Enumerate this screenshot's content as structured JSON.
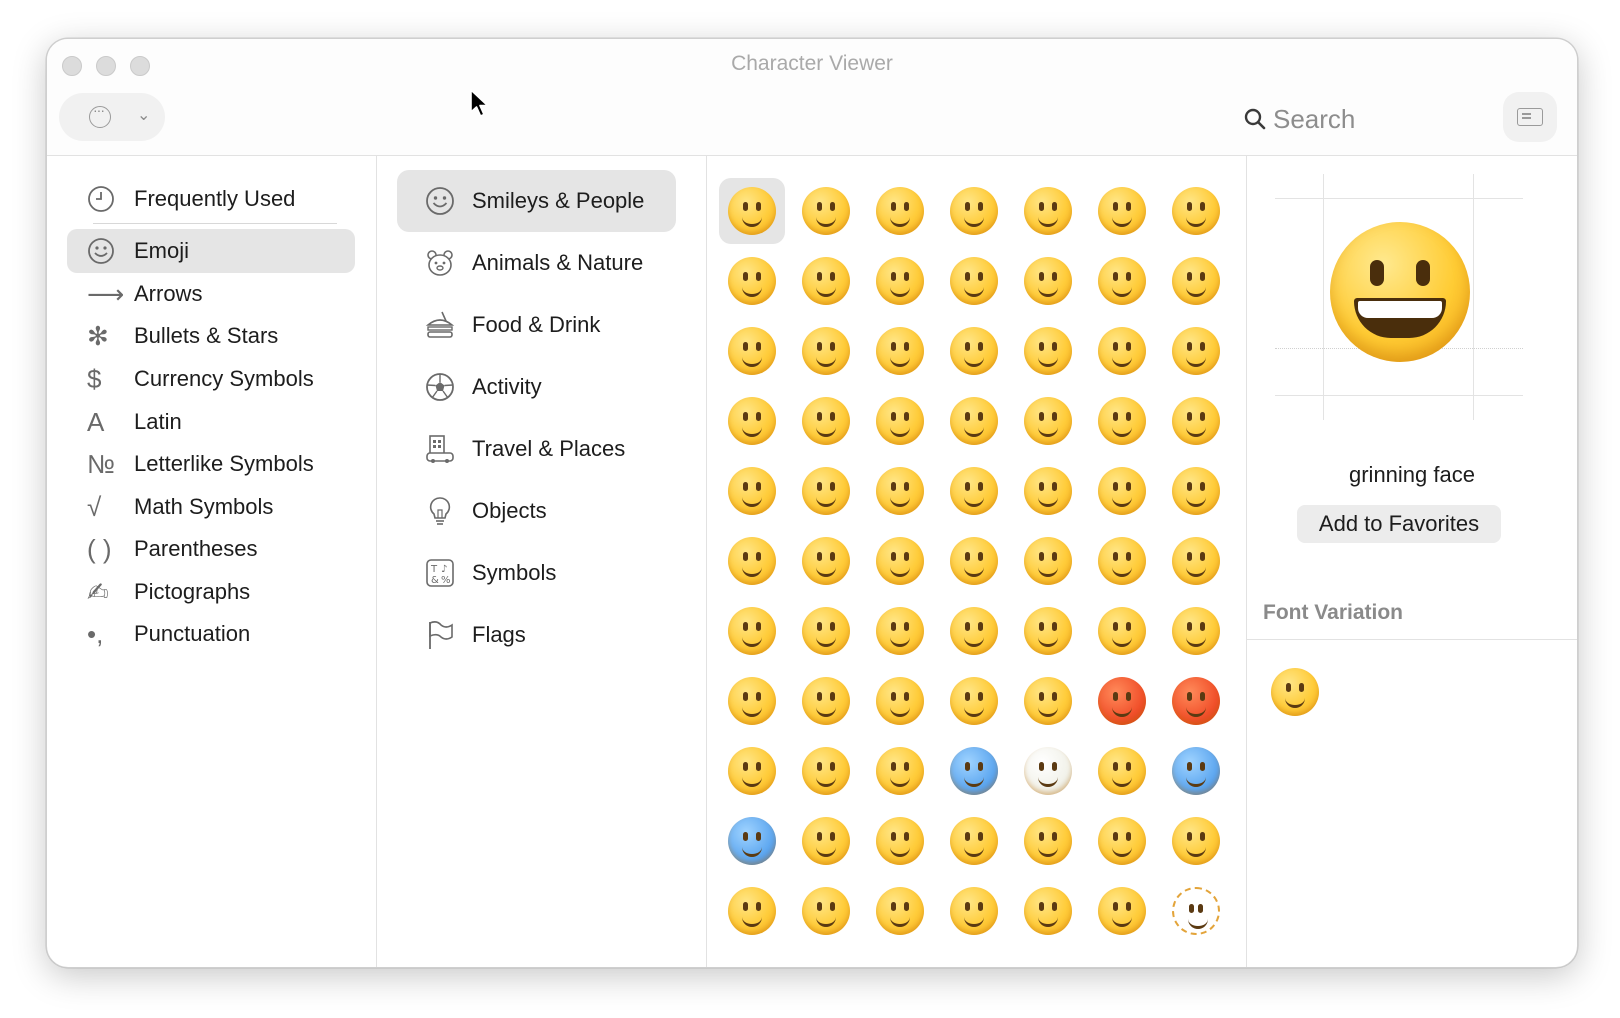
{
  "window": {
    "title": "Character Viewer"
  },
  "toolbar": {
    "search_label": "Search"
  },
  "sidebar": {
    "items": [
      {
        "label": "Frequently Used",
        "icon": "clock-icon",
        "glyph": ""
      },
      {
        "label": "Emoji",
        "icon": "smiley-icon",
        "glyph": ""
      },
      {
        "label": "Arrows",
        "icon": "arrow-icon",
        "glyph": "⟶"
      },
      {
        "label": "Bullets & Stars",
        "icon": "asterisk-icon",
        "glyph": "✻"
      },
      {
        "label": "Currency Symbols",
        "icon": "dollar-icon",
        "glyph": "$"
      },
      {
        "label": "Latin",
        "icon": "latin-a-icon",
        "glyph": "A"
      },
      {
        "label": "Letterlike Symbols",
        "icon": "numero-icon",
        "glyph": "№"
      },
      {
        "label": "Math Symbols",
        "icon": "square-root-icon",
        "glyph": "√"
      },
      {
        "label": "Parentheses",
        "icon": "parentheses-icon",
        "glyph": "( )"
      },
      {
        "label": "Pictographs",
        "icon": "pencil-icon",
        "glyph": "✍"
      },
      {
        "label": "Punctuation",
        "icon": "punctuation-icon",
        "glyph": "•,"
      }
    ],
    "selected": "Emoji"
  },
  "categories": {
    "items": [
      {
        "label": "Smileys & People",
        "icon": "smiley-icon"
      },
      {
        "label": "Animals & Nature",
        "icon": "bear-icon"
      },
      {
        "label": "Food & Drink",
        "icon": "burger-cup-icon"
      },
      {
        "label": "Activity",
        "icon": "soccer-ball-icon"
      },
      {
        "label": "Travel & Places",
        "icon": "building-car-icon"
      },
      {
        "label": "Objects",
        "icon": "lightbulb-icon"
      },
      {
        "label": "Symbols",
        "icon": "symbols-icon"
      },
      {
        "label": "Flags",
        "icon": "flag-icon"
      }
    ],
    "selected": "Smileys & People"
  },
  "emoji_grid": {
    "rows": 11,
    "columns": 7,
    "selected_index": 0
  },
  "detail": {
    "name": "grinning face",
    "add_button": "Add to Favorites",
    "font_variation_title": "Font Variation"
  }
}
